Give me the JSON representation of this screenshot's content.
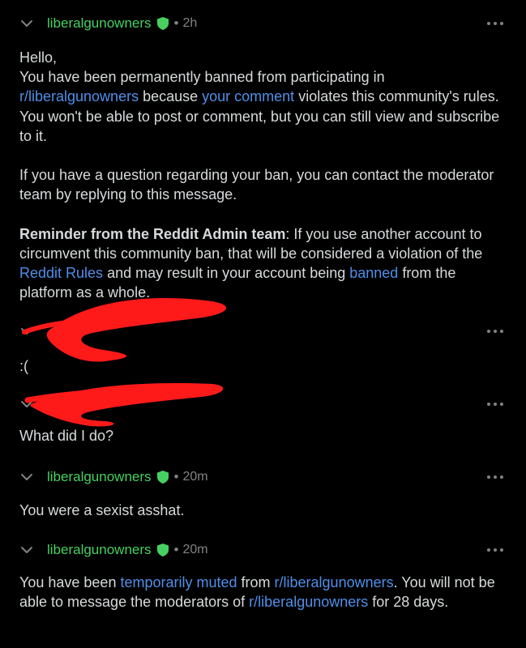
{
  "colors": {
    "background": "#000000",
    "text": "#d7dadc",
    "author": "#46d160",
    "link": "#4f8fe8",
    "meta": "#818384",
    "redaction": "#ff1a1a"
  },
  "icons": {
    "collapse": "chevron-down-icon",
    "mod": "shield-icon",
    "more": "more-options-icon"
  },
  "messages": [
    {
      "author": "liberalgunowners",
      "dot": "•",
      "time": "2h",
      "greeting": "Hello,",
      "line_a": "You have been permanently banned from participating in",
      "sub_link": "r/liberalgunowners",
      "because": " because ",
      "comment_link": "your comment",
      "violates": " violates this community's rules. You won't be able to post or comment, but you can still view and subscribe to it.",
      "question": "If you have a question regarding your ban, you can contact the moderator team by replying to this message.",
      "reminder_label": "Reminder from the Reddit Admin team",
      "reminder_a": ": If you use another account to circumvent this community ban, that will be considered a violation of the ",
      "rules_link": "Reddit Rules",
      "reminder_b": " and may result in your account being ",
      "banned_link": "banned",
      "reminder_c": " from the platform as a whole."
    },
    {
      "text": ":("
    },
    {
      "text": "What did I do?"
    },
    {
      "author": "liberalgunowners",
      "dot": "•",
      "time": "20m",
      "text": "You were a sexist asshat."
    },
    {
      "author": "liberalgunowners",
      "dot": "•",
      "time": "20m",
      "part_a": "You have been ",
      "muted_link": "temporarily muted",
      "part_b": " from ",
      "sub_link_1": "r/liberalgunowners",
      "part_c": ". You will not be able to message the moderators of ",
      "sub_link_2": "r/liberalgunowners",
      "part_d": " for 28 days."
    }
  ]
}
